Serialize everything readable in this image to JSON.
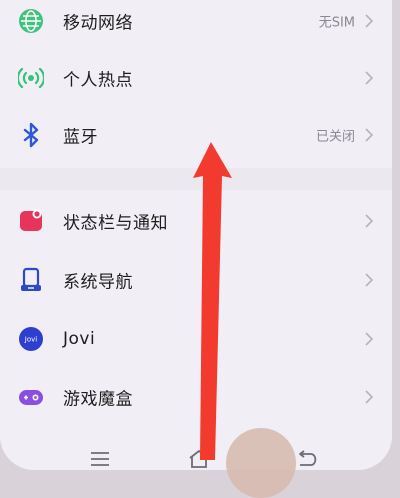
{
  "settings": {
    "items": [
      {
        "label": "移动网络",
        "value": "无SIM",
        "icon": "globe-icon"
      },
      {
        "label": "个人热点",
        "value": "",
        "icon": "hotspot-icon"
      },
      {
        "label": "蓝牙",
        "value": "已关闭",
        "icon": "bluetooth-icon"
      },
      {
        "label": "状态栏与通知",
        "value": "",
        "icon": "notification-icon"
      },
      {
        "label": "系统导航",
        "value": "",
        "icon": "navigation-icon"
      },
      {
        "label": "Jovi",
        "value": "",
        "icon": "jovi-icon"
      },
      {
        "label": "游戏魔盒",
        "value": "",
        "icon": "game-box-icon"
      }
    ]
  },
  "jovi_badge": "Jovi",
  "navbar": {
    "buttons": [
      "menu-icon",
      "home-icon",
      "back-icon"
    ]
  },
  "colors": {
    "background": "#f1eef5",
    "mobile_network_icon": "#3fc37f",
    "hotspot_icon": "#36c27a",
    "bluetooth_icon": "#2f58d8",
    "notification_icon": "#e6345b",
    "navigation_icon": "#2d49c6",
    "jovi_icon": "#2e3fcf",
    "game_box_icon": "#8a4ee0",
    "arrow": "#f23a2e"
  }
}
